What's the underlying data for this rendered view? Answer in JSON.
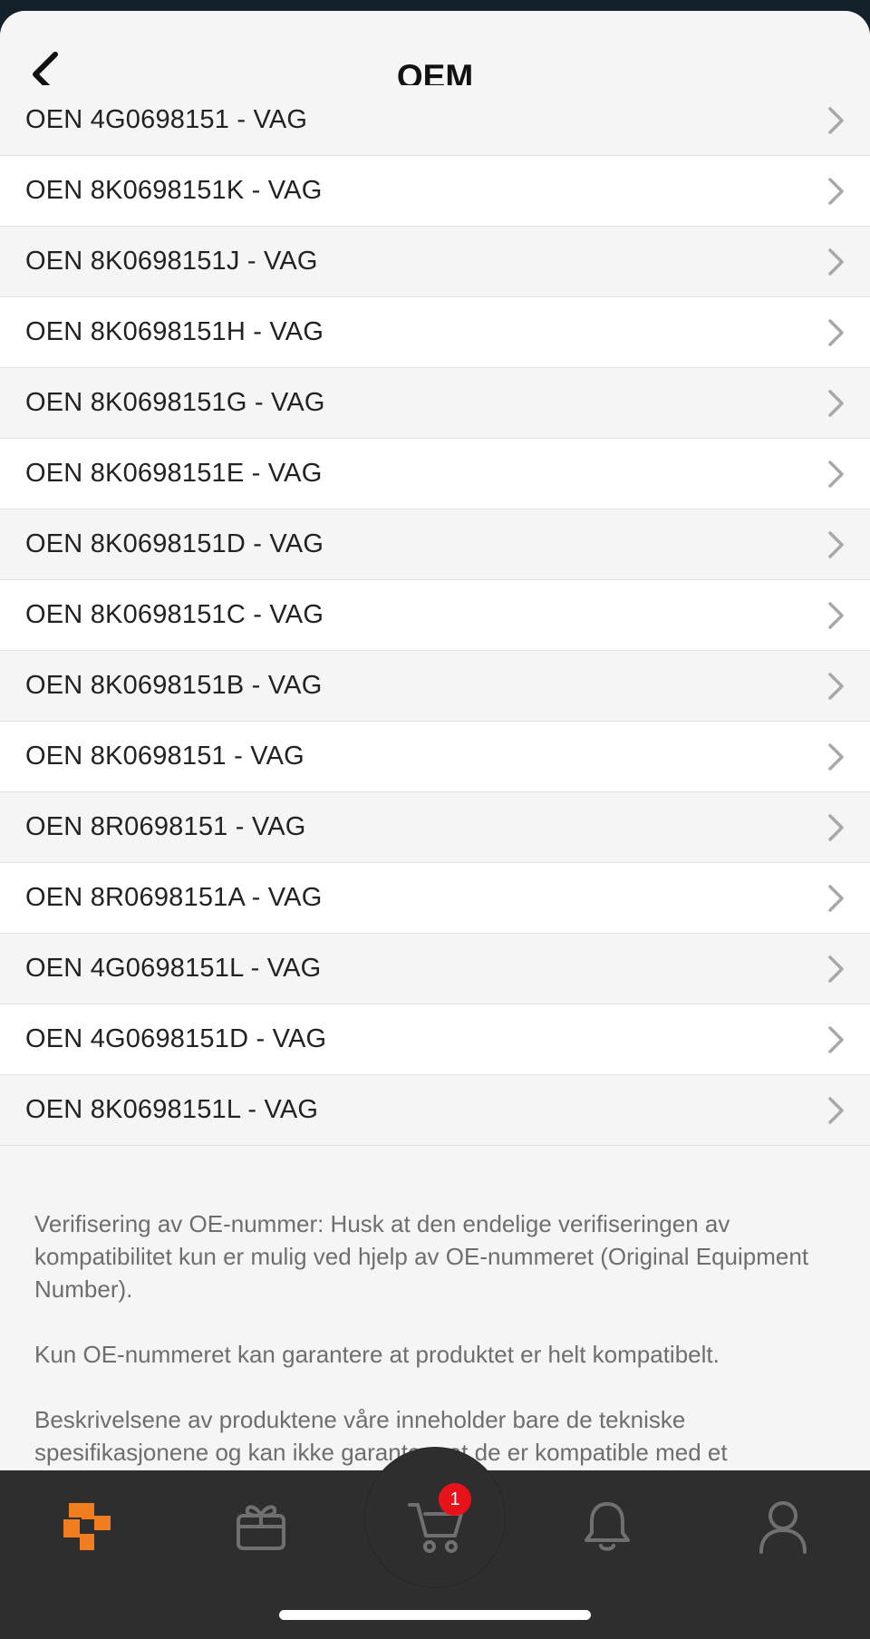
{
  "header": {
    "title": "OEM"
  },
  "list": {
    "items": [
      "OEN 4G0698151 - VAG",
      "OEN 8K0698151K - VAG",
      "OEN 8K0698151J - VAG",
      "OEN 8K0698151H - VAG",
      "OEN 8K0698151G - VAG",
      "OEN 8K0698151E - VAG",
      "OEN 8K0698151D - VAG",
      "OEN 8K0698151C - VAG",
      "OEN 8K0698151B - VAG",
      "OEN 8K0698151 - VAG",
      "OEN 8R0698151 - VAG",
      "OEN 8R0698151A - VAG",
      "OEN 4G0698151L - VAG",
      "OEN 4G0698151D - VAG",
      "OEN 8K0698151L - VAG"
    ]
  },
  "disclaimer": {
    "p1": "Verifisering av OE-nummer: Husk at den endelige verifiseringen av kompatibilitet kun er mulig ved hjelp av OE-nummeret (Original Equipment Number).",
    "p2": "Kun OE-nummeret kan garantere at produktet er helt kompatibelt.",
    "p3": "Beskrivelsene av produktene våre inneholder bare de tekniske spesifikasjonene og kan ikke garantere at de er kompatible med et"
  },
  "tabbar": {
    "cart_badge": "1",
    "accent_color": "#f07d1e",
    "icons": [
      "logo-icon",
      "gift-icon",
      "cart-icon",
      "bell-icon",
      "user-icon"
    ]
  }
}
